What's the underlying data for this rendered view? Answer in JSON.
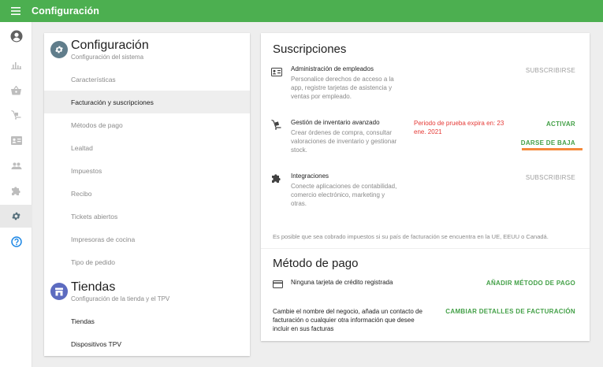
{
  "header": {
    "title": "Configuración",
    "menu_icon": "hamburger-menu-icon",
    "color": "#4caf50"
  },
  "rail": {
    "items": [
      {
        "name": "account-icon",
        "active": false
      },
      {
        "name": "reports-icon",
        "active": false
      },
      {
        "name": "items-basket-icon",
        "active": false
      },
      {
        "name": "inventory-icon",
        "active": false
      },
      {
        "name": "employees-card-icon",
        "active": false
      },
      {
        "name": "customers-icon",
        "active": false
      },
      {
        "name": "integrations-puzzle-icon",
        "active": false
      },
      {
        "name": "settings-gear-icon",
        "active": true
      },
      {
        "name": "help-icon",
        "active": false
      }
    ]
  },
  "sidebar": {
    "settings_section": {
      "title": "Configuración",
      "subtitle": "Configuración del sistema",
      "items": [
        {
          "label": "Características"
        },
        {
          "label": "Facturación y suscripciones",
          "selected": true
        },
        {
          "label": "Métodos de pago"
        },
        {
          "label": "Lealtad"
        },
        {
          "label": "Impuestos"
        },
        {
          "label": "Recibo"
        },
        {
          "label": "Tickets abiertos"
        },
        {
          "label": "Impresoras de cocina"
        },
        {
          "label": "Tipo de pedido"
        }
      ]
    },
    "stores_section": {
      "title": "Tiendas",
      "subtitle": "Configuración de la tienda y el TPV",
      "items": [
        {
          "label": "Tiendas"
        },
        {
          "label": "Dispositivos TPV"
        }
      ]
    }
  },
  "subscriptions": {
    "title": "Suscripciones",
    "items": [
      {
        "name": "Administración de empleados",
        "description": "Personalice derechos de acceso a la app, registre tarjetas de asistencia y ventas por empleado.",
        "action": "SUBSCRIBIRSE"
      },
      {
        "name": "Gestión de inventario avanzado",
        "description": "Crear órdenes de compra, consultar valoraciones de inventario y gestionar stock.",
        "trial": "Periodo de prueba expira en: 23 ene. 2021",
        "action": "ACTIVAR",
        "action2": "DARSE DE BAJA"
      },
      {
        "name": "Integraciones",
        "description": "Conecte aplicaciones de contabilidad, comercio electrónico, marketing y otras.",
        "action": "SUBSCRIBIRSE"
      }
    ],
    "tax_note": "Es posible que sea cobrado impuestos si su país de facturación se encuentra en la UE, EEUU o Canadá."
  },
  "payment": {
    "title": "Método de pago",
    "no_card": "Ninguna tarjeta de crédito registrada",
    "add_method": "AÑADIR MÉTODO DE PAGO",
    "billing_text": "Cambie el nombre del negocio, añada un contacto de facturación o cualquier otra información que desee incluir en sus facturas",
    "change_billing": "CAMBIAR DETALLES DE FACTURACIÓN"
  },
  "colors": {
    "accent": "#43a047",
    "trial": "#e53935",
    "highlight": "#f5893a"
  }
}
